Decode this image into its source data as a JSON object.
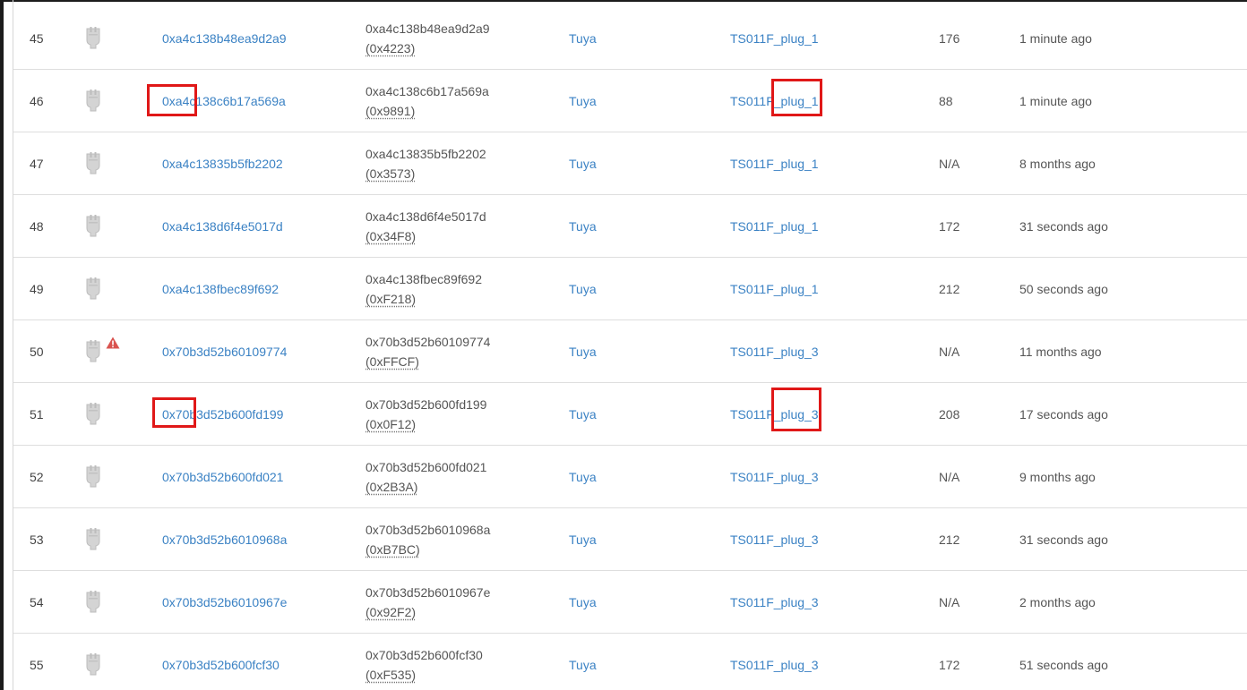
{
  "device_table": {
    "rows": [
      {
        "num": "45",
        "ieee": "0xa4c138b48ea9d2a9",
        "nwk_ieee": "0xa4c138b48ea9d2a9",
        "nwk_addr": "(0x4223)",
        "vendor": "Tuya",
        "model": "TS011F_plug_1",
        "lqi": "176",
        "last_seen": "1 minute ago",
        "icon": "smart-plug-icon",
        "warning": false
      },
      {
        "num": "46",
        "ieee": "0xa4c138c6b17a569a",
        "nwk_ieee": "0xa4c138c6b17a569a",
        "nwk_addr": "(0x9891)",
        "vendor": "Tuya",
        "model": "TS011F_plug_1",
        "lqi": "88",
        "last_seen": "1 minute ago",
        "icon": "smart-plug-icon",
        "warning": false
      },
      {
        "num": "47",
        "ieee": "0xa4c13835b5fb2202",
        "nwk_ieee": "0xa4c13835b5fb2202",
        "nwk_addr": "(0x3573)",
        "vendor": "Tuya",
        "model": "TS011F_plug_1",
        "lqi": "N/A",
        "last_seen": "8 months ago",
        "icon": "smart-plug-icon",
        "warning": false
      },
      {
        "num": "48",
        "ieee": "0xa4c138d6f4e5017d",
        "nwk_ieee": "0xa4c138d6f4e5017d",
        "nwk_addr": "(0x34F8)",
        "vendor": "Tuya",
        "model": "TS011F_plug_1",
        "lqi": "172",
        "last_seen": "31 seconds ago",
        "icon": "smart-plug-icon",
        "warning": false
      },
      {
        "num": "49",
        "ieee": "0xa4c138fbec89f692",
        "nwk_ieee": "0xa4c138fbec89f692",
        "nwk_addr": "(0xF218)",
        "vendor": "Tuya",
        "model": "TS011F_plug_1",
        "lqi": "212",
        "last_seen": "50 seconds ago",
        "icon": "smart-plug-icon",
        "warning": false
      },
      {
        "num": "50",
        "ieee": "0x70b3d52b60109774",
        "nwk_ieee": "0x70b3d52b60109774",
        "nwk_addr": "(0xFFCF)",
        "vendor": "Tuya",
        "model": "TS011F_plug_3",
        "lqi": "N/A",
        "last_seen": "11 months ago",
        "icon": "smart-plug-icon",
        "warning": true
      },
      {
        "num": "51",
        "ieee": "0x70b3d52b600fd199",
        "nwk_ieee": "0x70b3d52b600fd199",
        "nwk_addr": "(0x0F12)",
        "vendor": "Tuya",
        "model": "TS011F_plug_3",
        "lqi": "208",
        "last_seen": "17 seconds ago",
        "icon": "smart-plug-icon",
        "warning": false
      },
      {
        "num": "52",
        "ieee": "0x70b3d52b600fd021",
        "nwk_ieee": "0x70b3d52b600fd021",
        "nwk_addr": "(0x2B3A)",
        "vendor": "Tuya",
        "model": "TS011F_plug_3",
        "lqi": "N/A",
        "last_seen": "9 months ago",
        "icon": "smart-plug-icon",
        "warning": false
      },
      {
        "num": "53",
        "ieee": "0x70b3d52b6010968a",
        "nwk_ieee": "0x70b3d52b6010968a",
        "nwk_addr": "(0xB7BC)",
        "vendor": "Tuya",
        "model": "TS011F_plug_3",
        "lqi": "212",
        "last_seen": "31 seconds ago",
        "icon": "smart-plug-icon",
        "warning": false
      },
      {
        "num": "54",
        "ieee": "0x70b3d52b6010967e",
        "nwk_ieee": "0x70b3d52b6010967e",
        "nwk_addr": "(0x92F2)",
        "vendor": "Tuya",
        "model": "TS011F_plug_3",
        "lqi": "N/A",
        "last_seen": "2 months ago",
        "icon": "smart-plug-icon",
        "warning": false
      },
      {
        "num": "55",
        "ieee": "0x70b3d52b600fcf30",
        "nwk_ieee": "0x70b3d52b600fcf30",
        "nwk_addr": "(0xF535)",
        "vendor": "Tuya",
        "model": "TS011F_plug_3",
        "lqi": "172",
        "last_seen": "51 seconds ago",
        "icon": "smart-plug-icon",
        "warning": false
      }
    ]
  },
  "colors": {
    "link": "#3b82c4",
    "highlight_box": "#e01818",
    "warning": "#d9534f",
    "row_border": "#dedede"
  }
}
